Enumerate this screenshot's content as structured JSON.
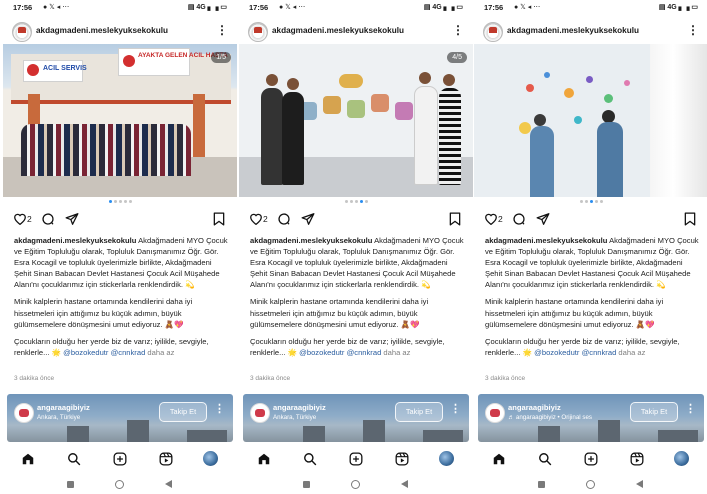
{
  "colors": {
    "accent": "#2b8ef0",
    "handle": "#2a5d9f",
    "muted": "#8a8a8a",
    "like_red": "#e34c5f"
  },
  "panels": [
    {
      "status": {
        "time": "17:56",
        "right": "▤ 4G ▖▗ ▭"
      },
      "username": "akdagmadeni.meslekyuksekokulu",
      "counter": "1/5",
      "likes": "2",
      "active_dot": 1,
      "caption_user": "akdagmadeni.meslekyuksekokulu",
      "caption_p1": "Akdağmadeni MYO Çocuk ve Eğitim Topluluğu olarak, Topluluk Danışmanımız Öğr. Gör. Esra Kocagil ve topluluk üyelerimizle birlikte, Akdağmadeni Şehit Sinan Babacan Devlet Hastanesi Çocuk Acil Müşahede Alanı'nı çocuklarımız için stickerlarla renklendirdik. 💫",
      "caption_p2": "Minik kalplerin hastane ortamında kendilerini daha iyi hissetmeleri için attığımız bu küçük adımın, büyük gülümsemelere dönüşmesini umut ediyoruz. 🧸💖",
      "caption_p3": "Çocukların olduğu her yerde biz de varız; iyilikle, sevgiyle, renklerle... 🌟",
      "mention1": "@bozokedutr",
      "mention2": "@cnnkrad",
      "more": "daha az",
      "ago": "3 dakika önce",
      "reel": {
        "name": "angaraagibiyiz",
        "sub": "Ankara, Türkiye",
        "follow": "Takip Et"
      },
      "scene_text": {
        "s1": "ACIL SERVIS",
        "s2": "AYAKTA GELEN ACIL HASTA"
      }
    },
    {
      "status": {
        "time": "17:56",
        "right": "▤ 4G ▖▗ ▭"
      },
      "username": "akdagmadeni.meslekyuksekokulu",
      "counter": "4/5",
      "likes": "2",
      "active_dot": 4,
      "caption_user": "akdagmadeni.meslekyuksekokulu",
      "caption_p1": "Akdağmadeni MYO Çocuk ve Eğitim Topluluğu olarak, Topluluk Danışmanımız Öğr. Gör. Esra Kocagil ve topluluk üyelerimizle birlikte, Akdağmadeni Şehit Sinan Babacan Devlet Hastanesi Çocuk Acil Müşahede Alanı'nı çocuklarımız için stickerlarla renklendirdik. 💫",
      "caption_p2": "Minik kalplerin hastane ortamında kendilerini daha iyi hissetmeleri için attığımız bu küçük adımın, büyük gülümsemelere dönüşmesini umut ediyoruz. 🧸💖",
      "caption_p3": "Çocukların olduğu her yerde biz de varız; iyilikle, sevgiyle, renklerle... 🌟",
      "mention1": "@bozokedutr",
      "mention2": "@cnnkrad",
      "more": "daha az",
      "ago": "3 dakika önce",
      "reel": {
        "name": "angaraagibiyiz",
        "sub": "Ankara, Türkiye",
        "follow": "Takip Et"
      }
    },
    {
      "status": {
        "time": "17:56",
        "right": "▤ 4G ▖▗ ▭"
      },
      "username": "akdagmadeni.meslekyuksekokulu",
      "counter": "",
      "likes": "2",
      "active_dot": 3,
      "caption_user": "akdagmadeni.meslekyuksekokulu",
      "caption_p1": "Akdağmadeni MYO Çocuk ve Eğitim Topluluğu olarak, Topluluk Danışmanımız Öğr. Gör. Esra Kocagil ve topluluk üyelerimizle birlikte, Akdağmadeni Şehit Sinan Babacan Devlet Hastanesi Çocuk Acil Müşahede Alanı'nı çocuklarımız için stickerlarla renklendirdik. 💫",
      "caption_p2": "Minik kalplerin hastane ortamında kendilerini daha iyi hissetmeleri için attığımız bu küçük adımın, büyük gülümsemelere dönüşmesini umut ediyoruz. 🧸💖",
      "caption_p3": "Çocukların olduğu her yerde biz de varız; iyilikle, sevgiyle, renklerle... 🌟",
      "mention1": "@bozokedutr",
      "mention2": "@cnnkrad",
      "more": "daha az",
      "ago": "3 dakika önce",
      "reel": {
        "name": "angaraagibiyiz",
        "sub": "♬ angaraagibiyiz • Orijinal ses",
        "follow": "Takip Et"
      }
    }
  ],
  "icons": [
    "heart-icon",
    "comment-icon",
    "share-icon",
    "bookmark-icon",
    "home-icon",
    "search-icon",
    "create-icon",
    "reels-icon",
    "profile-avatar"
  ]
}
